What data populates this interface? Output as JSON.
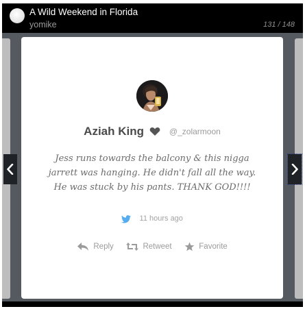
{
  "header": {
    "title": "A Wild Weekend in Florida",
    "author": "yomike",
    "counter": "131 / 148"
  },
  "tweet": {
    "name": "Aziah King",
    "handle": "@_zolarmoon",
    "text": "Jess runs towards the balcony & this nigga jarrett was hanging. He didn't fall all the way. He was stuck by his pants. THANK GOD!!!!",
    "time": "11 hours ago"
  },
  "actions": {
    "reply_label": "Reply",
    "retweet_label": "Retweet",
    "favorite_label": "Favorite"
  },
  "colors": {
    "stage_bg": "#555a60",
    "twitter_blue": "#55acee",
    "text_gray": "#6b6b6b"
  },
  "icons": {
    "nav_prev": "chevron-left-icon",
    "nav_next": "chevron-right-icon",
    "heart": "heart-icon",
    "twitter": "twitter-bird-icon",
    "reply": "reply-arrow-icon",
    "retweet": "retweet-icon",
    "favorite": "star-icon"
  }
}
